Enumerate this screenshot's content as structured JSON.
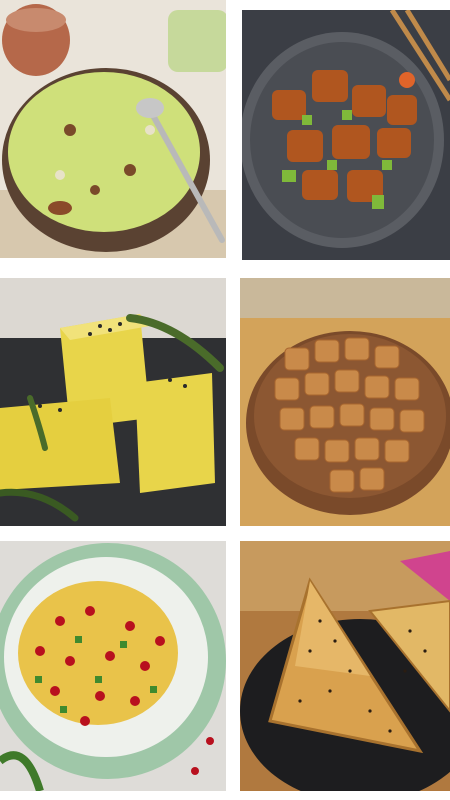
{
  "gallery": {
    "tiles": [
      {
        "icon": "poha-photo"
      },
      {
        "icon": "chilli-paneer-photo"
      },
      {
        "icon": "dhokla-photo"
      },
      {
        "icon": "shakarpara-photo"
      },
      {
        "icon": "sev-puri-photo"
      },
      {
        "icon": "samosa-puff-photo"
      }
    ]
  },
  "colors": {
    "background": "#ffffff",
    "poha": "#cfe07a",
    "paneer": "#b0561f",
    "dhokla": "#e8d54a",
    "shakarpara": "#c98a4a",
    "sev": "#e9c34a",
    "puff": "#d9a14e"
  }
}
